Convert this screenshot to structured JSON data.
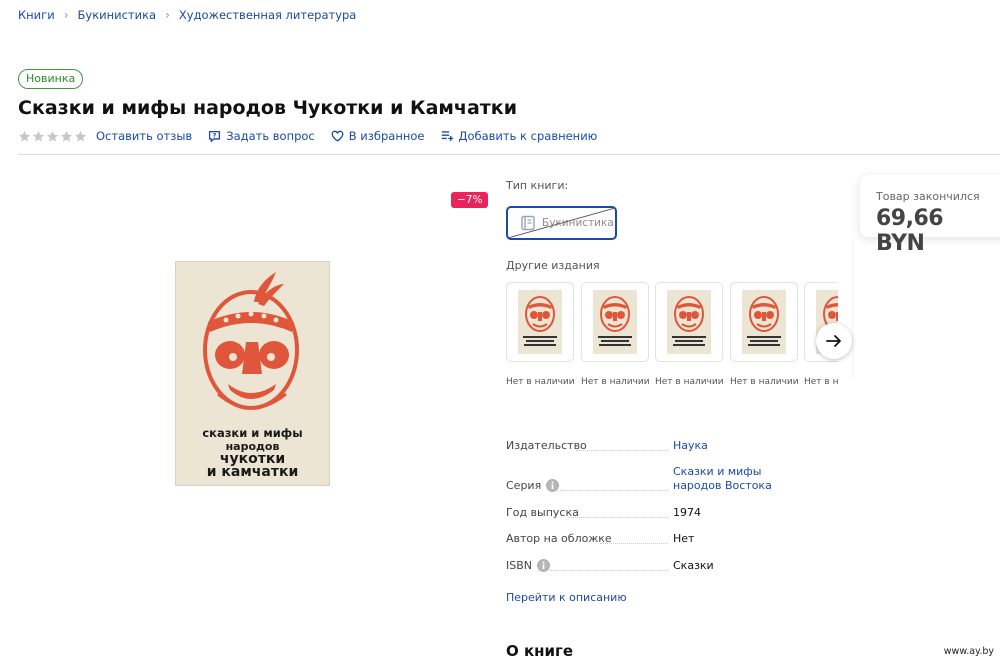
{
  "breadcrumb": [
    "Книги",
    "Букинистика",
    "Художественная литература"
  ],
  "badge": "Новинка",
  "title": "Сказки и мифы народов Чукотки и Камчатки",
  "actions": {
    "review": "Оставить отзыв",
    "ask": "Задать вопрос",
    "favorite": "В избранное",
    "compare": "Добавить к сравнению"
  },
  "rating": {
    "stars_filled": 0,
    "stars_total": 5
  },
  "discount": "−7%",
  "cover": {
    "line1": "сказки и мифы",
    "line2": "народов",
    "line3": "чукотки",
    "line4": "и камчатки"
  },
  "book_type": {
    "label": "Тип книги:",
    "option": "Букинистика"
  },
  "other_editions": {
    "label": "Другие издания",
    "items": [
      {
        "status": "Нет в наличии"
      },
      {
        "status": "Нет в наличии"
      },
      {
        "status": "Нет в наличии"
      },
      {
        "status": "Нет в наличии"
      },
      {
        "status": "Нет в наличии"
      }
    ]
  },
  "price_card": {
    "sold_out": "Товар закончился",
    "price": "69,66 BYN"
  },
  "specs": [
    {
      "key": "Издательство",
      "value": "Наука",
      "link": true
    },
    {
      "key": "Серия",
      "value": "Сказки и мифы народов Востока",
      "link": true,
      "info": true
    },
    {
      "key": "Год выпуска",
      "value": "1974",
      "link": false
    },
    {
      "key": "Автор на обложке",
      "value": "Нет",
      "link": false
    },
    {
      "key": "ISBN",
      "value": "Сказки",
      "link": false,
      "info": true
    }
  ],
  "goto_description": "Перейти к описанию",
  "about_heading": "О книге",
  "watermark": "www.ay.by",
  "colors": {
    "link": "#1a4aa8",
    "badge_green": "#2f8a2f",
    "discount_red": "#e8245b",
    "mask_orange": "#e0563a"
  }
}
